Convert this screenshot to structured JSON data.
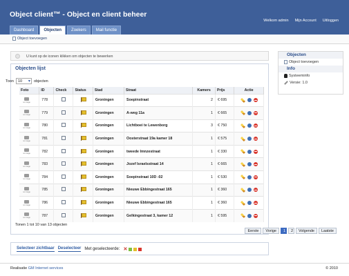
{
  "header": {
    "title": "Object client™ - Object en client beheer",
    "top_links": [
      "Welkom admin",
      "Mijn Account",
      "Uitloggen"
    ],
    "tabs": [
      "Dashboard",
      "Objecten",
      "Zoekers",
      "Mail functie"
    ],
    "active_tab": "Objecten"
  },
  "subbar": {
    "add_object": "Object toevoegen"
  },
  "notice": {
    "text": "U kunt op de iconen klikken om objecten te bewerken"
  },
  "list": {
    "title": "Objecten lijst",
    "show_prefix": "Toon",
    "show_value": "10",
    "show_suffix": "objecten",
    "columns": [
      "Foto",
      "ID",
      "Check",
      "Status",
      "Stad",
      "Straat",
      "Kamers",
      "Prijs",
      "Actie"
    ],
    "photo_label": "no image",
    "rows": [
      {
        "id": "778",
        "stad": "Groningen",
        "straat": "Soepinstraat",
        "kamers": "2",
        "prijs": "€ 695"
      },
      {
        "id": "779",
        "stad": "Groningen",
        "straat": "A-weg 11a",
        "kamers": "1",
        "prijs": "€ 665"
      },
      {
        "id": "780",
        "stad": "Groningen",
        "straat": "Lichtboei te Lewenborg",
        "kamers": "3",
        "prijs": "€ 750"
      },
      {
        "id": "781",
        "stad": "Groningen",
        "straat": "Oosterstraat 19a kamer 18",
        "kamers": "1",
        "prijs": "€ 575"
      },
      {
        "id": "782",
        "stad": "Groningen",
        "straat": "tweede Imnzestraat",
        "kamers": "1",
        "prijs": "€ 330"
      },
      {
        "id": "783",
        "stad": "Groningen",
        "straat": "Jozef Israelsstraat 14",
        "kamers": "1",
        "prijs": "€ 665"
      },
      {
        "id": "784",
        "stad": "Groningen",
        "straat": "Soepinstraat 10D -02",
        "kamers": "1",
        "prijs": "€ 530"
      },
      {
        "id": "785",
        "stad": "Groningen",
        "straat": "Nieuwe Ebbingestraat 165",
        "kamers": "1",
        "prijs": "€ 360"
      },
      {
        "id": "786",
        "stad": "Groningen",
        "straat": "Nieuwe Ebbingestraat 165",
        "kamers": "1",
        "prijs": "€ 360"
      },
      {
        "id": "787",
        "stad": "Groningen",
        "straat": "Gelkingestraat 3, kamer 12",
        "kamers": "1",
        "prijs": "€ 595"
      }
    ],
    "results_text": "Tonen 1 tot 10 van 13 objecten",
    "pager": {
      "first": "Eerste",
      "prev": "Vorige",
      "pages": [
        "1",
        "2"
      ],
      "active_page": "1",
      "next": "Volgende",
      "last": "Laatste"
    }
  },
  "actions": {
    "select_visible": "Selecteer zichtbaar",
    "deselect": "Deselecteer",
    "with_selected": "Met geselecteerde:"
  },
  "sidebar": {
    "objects_title": "Objecten",
    "objects_items": [
      "Object toevoegen"
    ],
    "info_title": "Info",
    "info_items": [
      "Systeeminfo",
      "Versie: 1.0"
    ]
  },
  "footer": {
    "left_prefix": "Realisatie",
    "left_link": "GM Internet services",
    "right": "© 2010"
  },
  "colors": {
    "header": "#3e5f99",
    "tab": "#6f91c7",
    "link": "#2f5ca3",
    "status_flag": "#e4bf2d",
    "delete": "#d9362d"
  }
}
